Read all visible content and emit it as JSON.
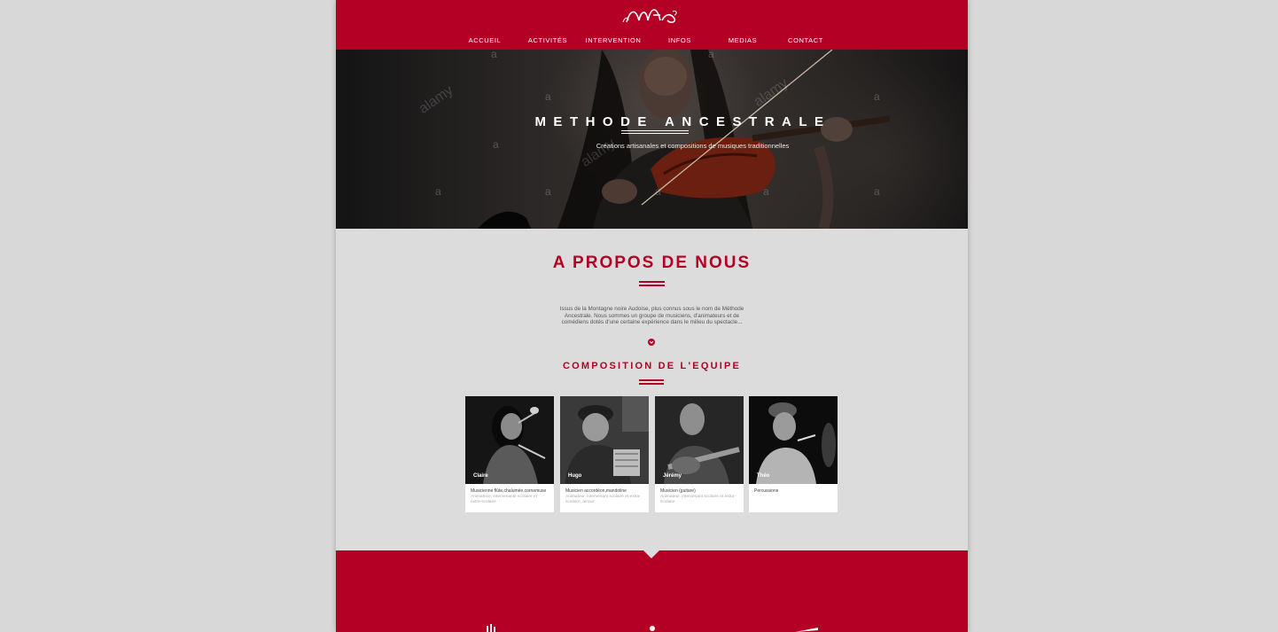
{
  "brand": {
    "logo": "MA",
    "accent_color": "#b30024"
  },
  "nav": [
    {
      "label": "ACCUEIL"
    },
    {
      "label": "ACTIVITÉS"
    },
    {
      "label": "INTERVENTION"
    },
    {
      "label": "INFOS"
    },
    {
      "label": "MEDIAS"
    },
    {
      "label": "CONTACT"
    }
  ],
  "hero": {
    "title": "METHODE ANCESTRALE",
    "subtitle": "Créations artisanales et compositions de musiques traditionnelles",
    "watermark": "alamy",
    "watermark_letter": "a"
  },
  "about": {
    "title": "A PROPOS DE NOUS",
    "text": "Issus de la Montagne noire Audoise, plus connus sous le nom de Méthode Ancestrale. Nous sommes un groupe de musiciens, d'animateurs et de comédiens dotés d'une certaine expérience dans le milieu du spectacle...",
    "more_icon": "chevron-down-icon"
  },
  "team": {
    "title": "COMPOSITION DE L'EQUIPE",
    "members": [
      {
        "name": "Claire",
        "role": "Musicienne flûte,chalumée,cornemuse",
        "desc": "Animatrice, intervenante scolaire et extra-scolaire"
      },
      {
        "name": "Hugo",
        "role": "Musicien accordéon,mandoline",
        "desc": "Animateur, intervenant scolaire et extra-scolaire, amour"
      },
      {
        "name": "Jérémy",
        "role": "Musicien (guitare)",
        "desc": "Animateur, intervenant scolaire et extra-scolaire"
      },
      {
        "name": "Théo",
        "role": "Percussions",
        "desc": ""
      }
    ]
  }
}
